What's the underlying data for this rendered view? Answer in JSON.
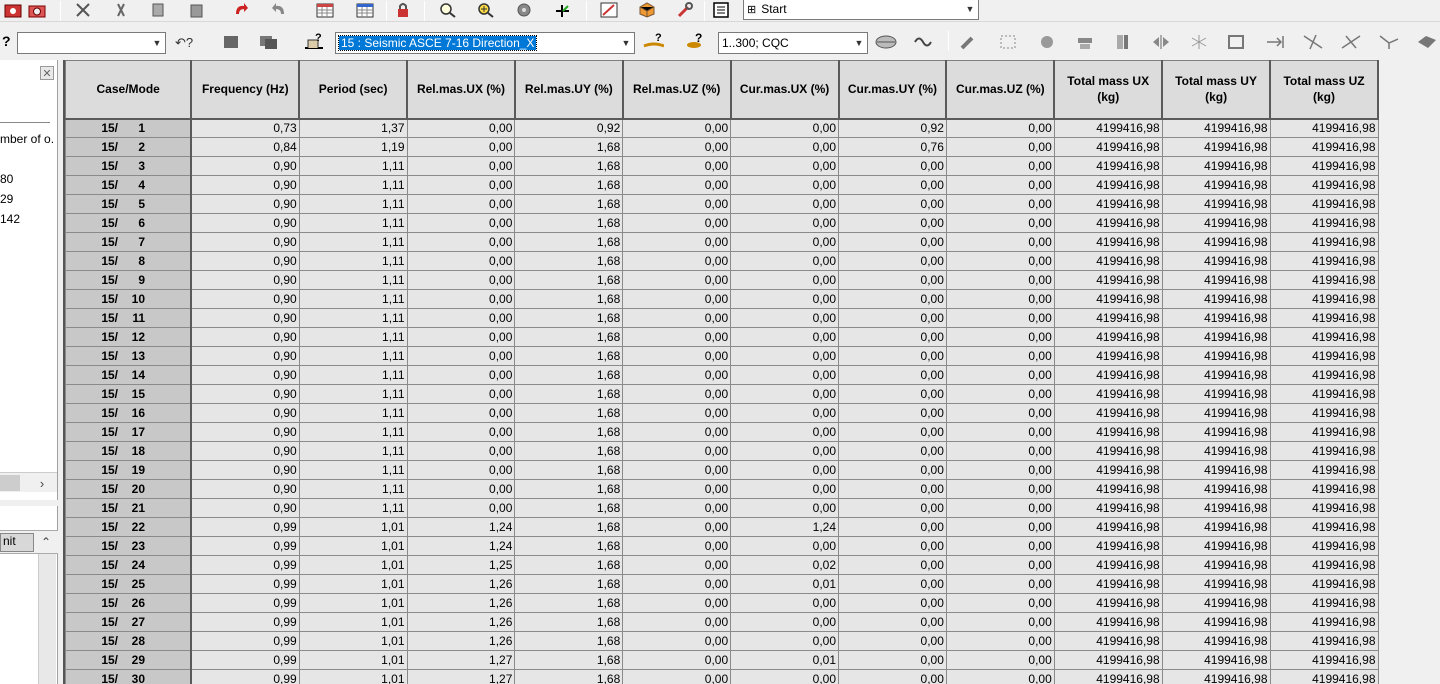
{
  "toolbar": {
    "view_select": "Start",
    "empty_combo": "",
    "case_select": "15 : Seismic ASCE 7-16 Direction_X",
    "combination_select": "1..300; CQC"
  },
  "left_panel": {
    "text_lines": [
      "mber of o.",
      "80",
      "29",
      "142"
    ],
    "bottom_label": "nit"
  },
  "table": {
    "columns": [
      "Case/Mode",
      "Frequency (Hz)",
      "Period (sec)",
      "Rel.mas.UX (%)",
      "Rel.mas.UY (%)",
      "Rel.mas.UZ (%)",
      "Cur.mas.UX (%)",
      "Cur.mas.UY (%)",
      "Cur.mas.UZ (%)",
      "Total mass UX (kg)",
      "Total mass UY (kg)",
      "Total mass UZ (kg)"
    ],
    "rows": [
      [
        "15/",
        "1",
        "0,73",
        "1,37",
        "0,00",
        "0,92",
        "0,00",
        "0,00",
        "0,92",
        "0,00",
        "4199416,98",
        "4199416,98",
        "4199416,98"
      ],
      [
        "15/",
        "2",
        "0,84",
        "1,19",
        "0,00",
        "1,68",
        "0,00",
        "0,00",
        "0,76",
        "0,00",
        "4199416,98",
        "4199416,98",
        "4199416,98"
      ],
      [
        "15/",
        "3",
        "0,90",
        "1,11",
        "0,00",
        "1,68",
        "0,00",
        "0,00",
        "0,00",
        "0,00",
        "4199416,98",
        "4199416,98",
        "4199416,98"
      ],
      [
        "15/",
        "4",
        "0,90",
        "1,11",
        "0,00",
        "1,68",
        "0,00",
        "0,00",
        "0,00",
        "0,00",
        "4199416,98",
        "4199416,98",
        "4199416,98"
      ],
      [
        "15/",
        "5",
        "0,90",
        "1,11",
        "0,00",
        "1,68",
        "0,00",
        "0,00",
        "0,00",
        "0,00",
        "4199416,98",
        "4199416,98",
        "4199416,98"
      ],
      [
        "15/",
        "6",
        "0,90",
        "1,11",
        "0,00",
        "1,68",
        "0,00",
        "0,00",
        "0,00",
        "0,00",
        "4199416,98",
        "4199416,98",
        "4199416,98"
      ],
      [
        "15/",
        "7",
        "0,90",
        "1,11",
        "0,00",
        "1,68",
        "0,00",
        "0,00",
        "0,00",
        "0,00",
        "4199416,98",
        "4199416,98",
        "4199416,98"
      ],
      [
        "15/",
        "8",
        "0,90",
        "1,11",
        "0,00",
        "1,68",
        "0,00",
        "0,00",
        "0,00",
        "0,00",
        "4199416,98",
        "4199416,98",
        "4199416,98"
      ],
      [
        "15/",
        "9",
        "0,90",
        "1,11",
        "0,00",
        "1,68",
        "0,00",
        "0,00",
        "0,00",
        "0,00",
        "4199416,98",
        "4199416,98",
        "4199416,98"
      ],
      [
        "15/",
        "10",
        "0,90",
        "1,11",
        "0,00",
        "1,68",
        "0,00",
        "0,00",
        "0,00",
        "0,00",
        "4199416,98",
        "4199416,98",
        "4199416,98"
      ],
      [
        "15/",
        "11",
        "0,90",
        "1,11",
        "0,00",
        "1,68",
        "0,00",
        "0,00",
        "0,00",
        "0,00",
        "4199416,98",
        "4199416,98",
        "4199416,98"
      ],
      [
        "15/",
        "12",
        "0,90",
        "1,11",
        "0,00",
        "1,68",
        "0,00",
        "0,00",
        "0,00",
        "0,00",
        "4199416,98",
        "4199416,98",
        "4199416,98"
      ],
      [
        "15/",
        "13",
        "0,90",
        "1,11",
        "0,00",
        "1,68",
        "0,00",
        "0,00",
        "0,00",
        "0,00",
        "4199416,98",
        "4199416,98",
        "4199416,98"
      ],
      [
        "15/",
        "14",
        "0,90",
        "1,11",
        "0,00",
        "1,68",
        "0,00",
        "0,00",
        "0,00",
        "0,00",
        "4199416,98",
        "4199416,98",
        "4199416,98"
      ],
      [
        "15/",
        "15",
        "0,90",
        "1,11",
        "0,00",
        "1,68",
        "0,00",
        "0,00",
        "0,00",
        "0,00",
        "4199416,98",
        "4199416,98",
        "4199416,98"
      ],
      [
        "15/",
        "16",
        "0,90",
        "1,11",
        "0,00",
        "1,68",
        "0,00",
        "0,00",
        "0,00",
        "0,00",
        "4199416,98",
        "4199416,98",
        "4199416,98"
      ],
      [
        "15/",
        "17",
        "0,90",
        "1,11",
        "0,00",
        "1,68",
        "0,00",
        "0,00",
        "0,00",
        "0,00",
        "4199416,98",
        "4199416,98",
        "4199416,98"
      ],
      [
        "15/",
        "18",
        "0,90",
        "1,11",
        "0,00",
        "1,68",
        "0,00",
        "0,00",
        "0,00",
        "0,00",
        "4199416,98",
        "4199416,98",
        "4199416,98"
      ],
      [
        "15/",
        "19",
        "0,90",
        "1,11",
        "0,00",
        "1,68",
        "0,00",
        "0,00",
        "0,00",
        "0,00",
        "4199416,98",
        "4199416,98",
        "4199416,98"
      ],
      [
        "15/",
        "20",
        "0,90",
        "1,11",
        "0,00",
        "1,68",
        "0,00",
        "0,00",
        "0,00",
        "0,00",
        "4199416,98",
        "4199416,98",
        "4199416,98"
      ],
      [
        "15/",
        "21",
        "0,90",
        "1,11",
        "0,00",
        "1,68",
        "0,00",
        "0,00",
        "0,00",
        "0,00",
        "4199416,98",
        "4199416,98",
        "4199416,98"
      ],
      [
        "15/",
        "22",
        "0,99",
        "1,01",
        "1,24",
        "1,68",
        "0,00",
        "1,24",
        "0,00",
        "0,00",
        "4199416,98",
        "4199416,98",
        "4199416,98"
      ],
      [
        "15/",
        "23",
        "0,99",
        "1,01",
        "1,24",
        "1,68",
        "0,00",
        "0,00",
        "0,00",
        "0,00",
        "4199416,98",
        "4199416,98",
        "4199416,98"
      ],
      [
        "15/",
        "24",
        "0,99",
        "1,01",
        "1,25",
        "1,68",
        "0,00",
        "0,02",
        "0,00",
        "0,00",
        "4199416,98",
        "4199416,98",
        "4199416,98"
      ],
      [
        "15/",
        "25",
        "0,99",
        "1,01",
        "1,26",
        "1,68",
        "0,00",
        "0,01",
        "0,00",
        "0,00",
        "4199416,98",
        "4199416,98",
        "4199416,98"
      ],
      [
        "15/",
        "26",
        "0,99",
        "1,01",
        "1,26",
        "1,68",
        "0,00",
        "0,00",
        "0,00",
        "0,00",
        "4199416,98",
        "4199416,98",
        "4199416,98"
      ],
      [
        "15/",
        "27",
        "0,99",
        "1,01",
        "1,26",
        "1,68",
        "0,00",
        "0,00",
        "0,00",
        "0,00",
        "4199416,98",
        "4199416,98",
        "4199416,98"
      ],
      [
        "15/",
        "28",
        "0,99",
        "1,01",
        "1,26",
        "1,68",
        "0,00",
        "0,00",
        "0,00",
        "0,00",
        "4199416,98",
        "4199416,98",
        "4199416,98"
      ],
      [
        "15/",
        "29",
        "0,99",
        "1,01",
        "1,27",
        "1,68",
        "0,00",
        "0,01",
        "0,00",
        "0,00",
        "4199416,98",
        "4199416,98",
        "4199416,98"
      ],
      [
        "15/",
        "30",
        "0,99",
        "1,01",
        "1,27",
        "1,68",
        "0,00",
        "0,00",
        "0,00",
        "0,00",
        "4199416,98",
        "4199416,98",
        "4199416,98"
      ]
    ]
  }
}
